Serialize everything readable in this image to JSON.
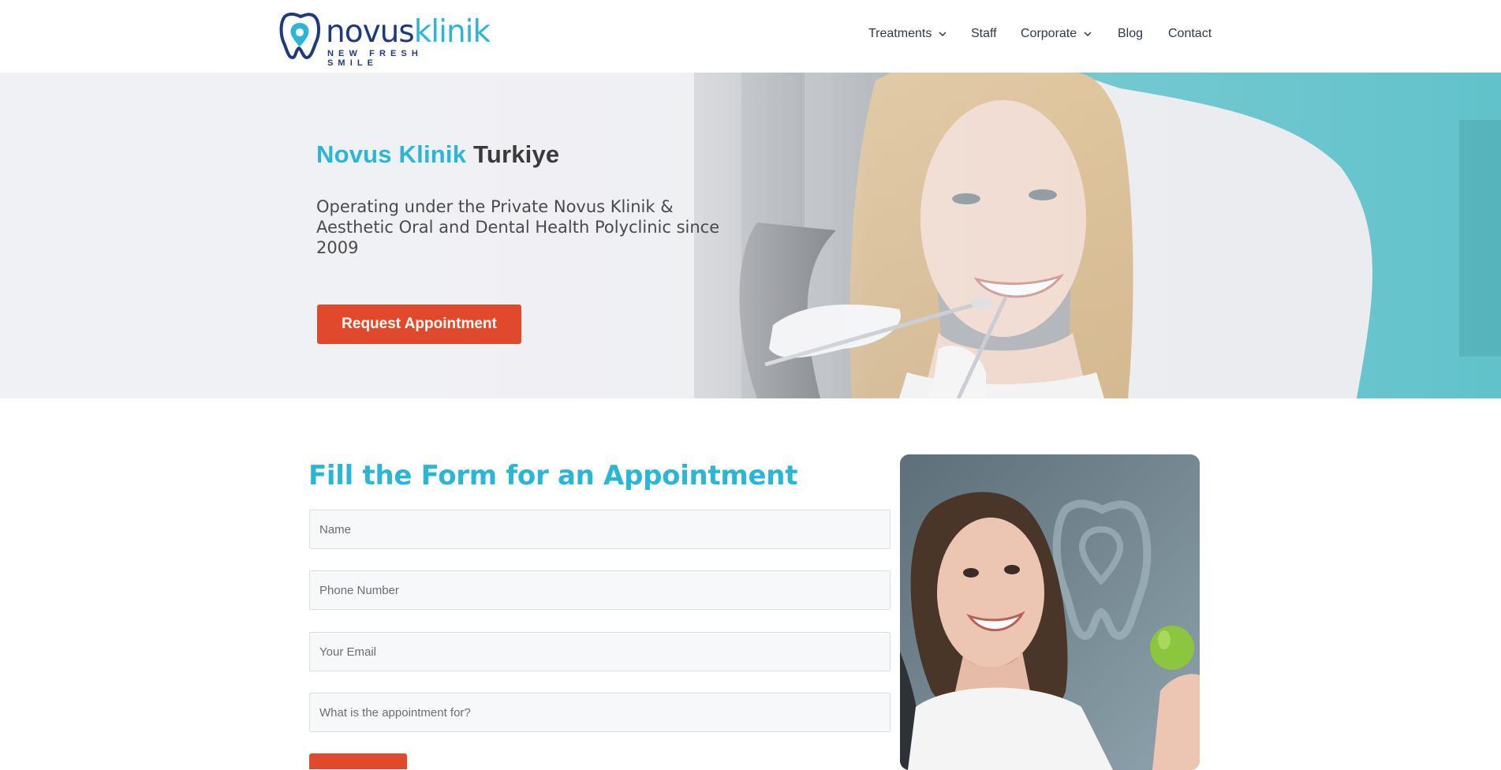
{
  "brand": {
    "name_part1": "novus",
    "name_part2": "klinik",
    "tagline": "NEW FRESH SMILE"
  },
  "nav": {
    "items": [
      {
        "label": "Treatments",
        "has_dropdown": true
      },
      {
        "label": "Staff",
        "has_dropdown": false
      },
      {
        "label": "Corporate",
        "has_dropdown": true
      },
      {
        "label": "Blog",
        "has_dropdown": false
      },
      {
        "label": "Contact",
        "has_dropdown": false
      }
    ]
  },
  "hero": {
    "title_highlight": "Novus Klinik",
    "title_rest": "Turkiye",
    "subtitle": "Operating under the Private Novus Klinik & Aesthetic Oral and Dental Health Polyclinic since 2009",
    "cta_label": "Request Appointment"
  },
  "form": {
    "title": "Fill the Form for an Appointment",
    "fields": [
      {
        "placeholder": "Name"
      },
      {
        "placeholder": "Phone Number"
      },
      {
        "placeholder": "Your Email"
      },
      {
        "placeholder": "What is the appointment for?"
      }
    ]
  },
  "colors": {
    "accent": "#2bb6d6",
    "brand_dark": "#1f3a7a",
    "cta": "#e04a2a"
  }
}
